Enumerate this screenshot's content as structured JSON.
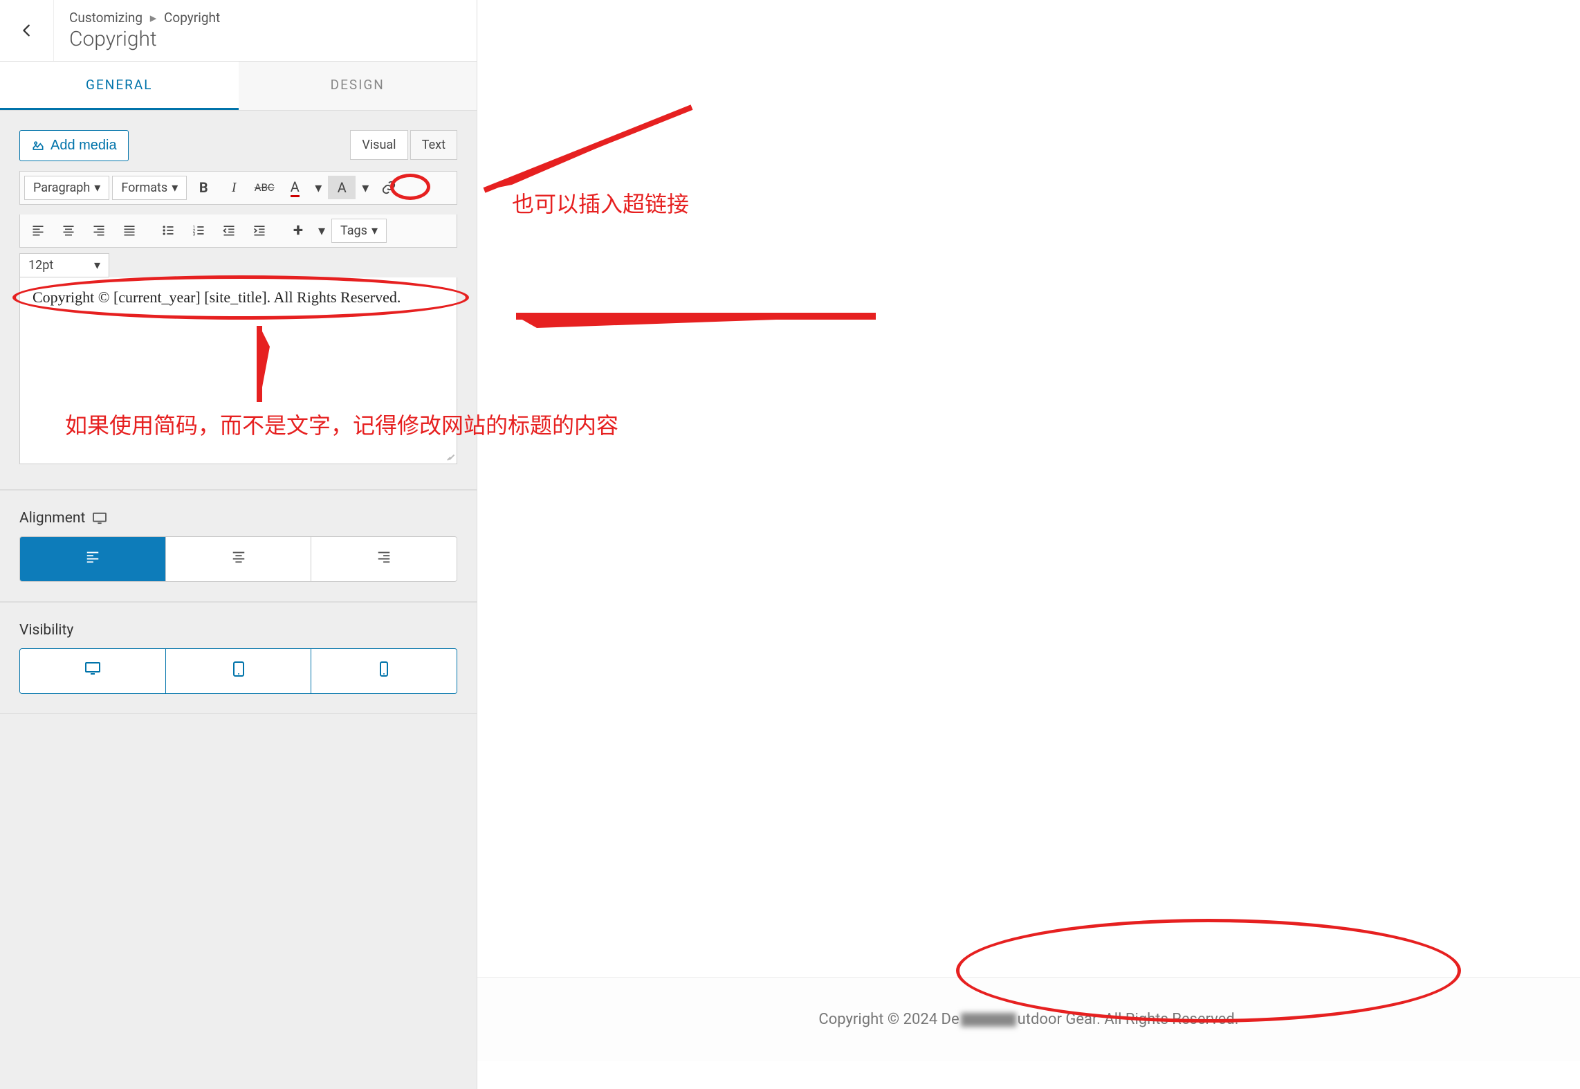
{
  "header": {
    "breadcrumb_root": "Customizing",
    "breadcrumb_sep": "▸",
    "breadcrumb_leaf": "Copyright",
    "title": "Copyright"
  },
  "tabs": {
    "general": "GENERAL",
    "design": "DESIGN"
  },
  "editor": {
    "add_media": "Add media",
    "visual_tab": "Visual",
    "text_tab": "Text",
    "paragraph_label": "Paragraph",
    "formats_label": "Formats",
    "tags_label": "Tags",
    "font_size": "12pt",
    "content": "Copyright © [current_year] [site_title]. All Rights Reserved."
  },
  "alignment": {
    "label": "Alignment"
  },
  "visibility": {
    "label": "Visibility"
  },
  "preview": {
    "footer_text_pre": "Copyright © 2024 De",
    "footer_text_post": "utdoor Gear. All Rights Reserved."
  },
  "annotations": {
    "link_note": "也可以插入超链接",
    "shortcode_note": "如果使用简码，而不是文字，记得修改网站的标题的内容"
  }
}
